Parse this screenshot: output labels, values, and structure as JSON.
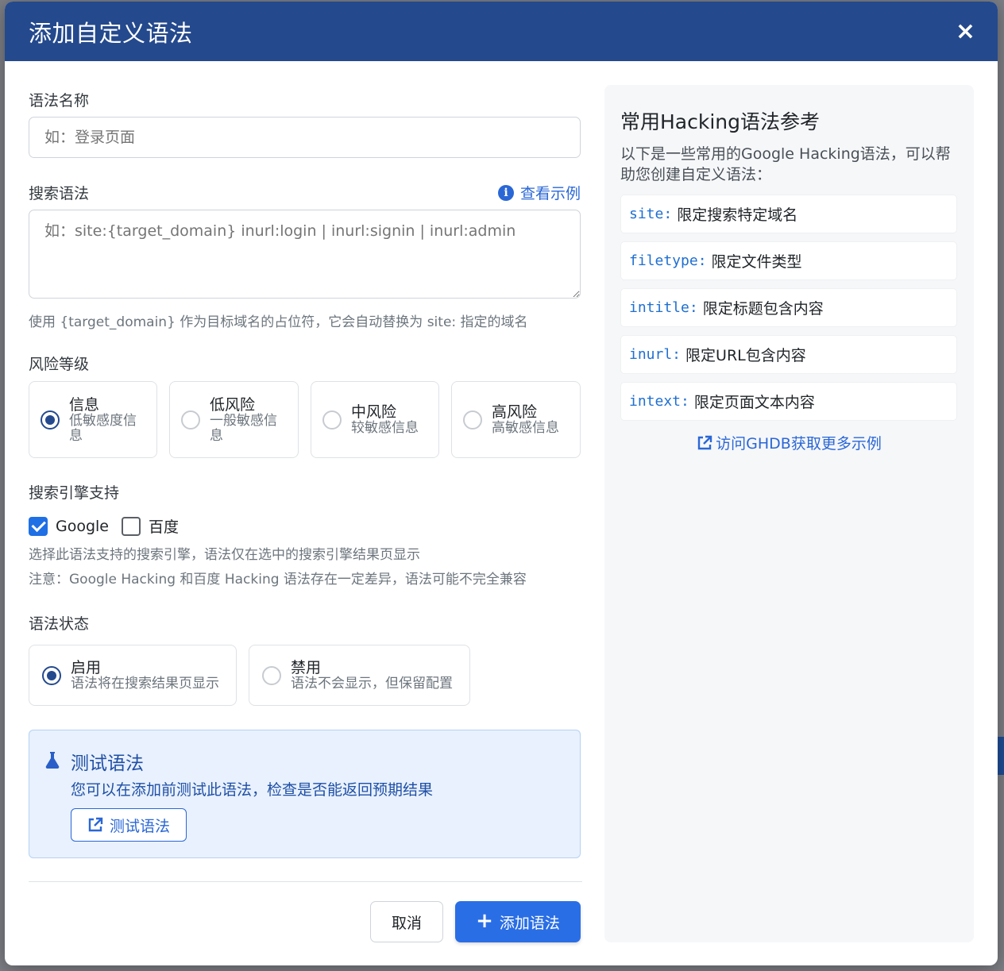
{
  "modal": {
    "title": "添加自定义语法",
    "close_label": "×"
  },
  "form": {
    "name_label": "语法名称",
    "name_placeholder": "如：登录页面",
    "syntax_label": "搜索语法",
    "view_example_label": "查看示例",
    "syntax_placeholder": "如：site:{target_domain} inurl:login | inurl:signin | inurl:admin",
    "syntax_help": "使用 {target_domain} 作为目标域名的占位符，它会自动替换为 site: 指定的域名",
    "risk_label": "风险等级",
    "risk_options": [
      {
        "title": "信息",
        "desc": "低敏感度信息",
        "checked": true
      },
      {
        "title": "低风险",
        "desc": "一般敏感信息",
        "checked": false
      },
      {
        "title": "中风险",
        "desc": "较敏感信息",
        "checked": false
      },
      {
        "title": "高风险",
        "desc": "高敏感信息",
        "checked": false
      }
    ],
    "engine_label": "搜索引擎支持",
    "engines": [
      {
        "label": "Google",
        "checked": true
      },
      {
        "label": "百度",
        "checked": false
      }
    ],
    "engine_help_1": "选择此语法支持的搜索引擎，语法仅在选中的搜索引擎结果页显示",
    "engine_help_2": "注意：Google Hacking 和百度 Hacking 语法存在一定差异，语法可能不完全兼容",
    "status_label": "语法状态",
    "status_options": [
      {
        "title": "启用",
        "desc": "语法将在搜索结果页显示",
        "checked": true
      },
      {
        "title": "禁用",
        "desc": "语法不会显示，但保留配置",
        "checked": false
      }
    ],
    "test": {
      "title": "测试语法",
      "desc": "您可以在添加前测试此语法，检查是否能返回预期结果",
      "button_label": "测试语法"
    },
    "cancel_label": "取消",
    "submit_label": "添加语法"
  },
  "reference": {
    "title": "常用Hacking语法参考",
    "desc": "以下是一些常用的Google Hacking语法，可以帮助您创建自定义语法：",
    "items": [
      {
        "code": "site:",
        "text": "限定搜索特定域名"
      },
      {
        "code": "filetype:",
        "text": "限定文件类型"
      },
      {
        "code": "intitle:",
        "text": "限定标题包含内容"
      },
      {
        "code": "inurl:",
        "text": "限定URL包含内容"
      },
      {
        "code": "intext:",
        "text": "限定页面文本内容"
      }
    ],
    "ghdb_link": "访问GHDB获取更多示例"
  },
  "colors": {
    "header_bg": "#24498d",
    "primary": "#2a6ee6",
    "link": "#2a67d6"
  }
}
